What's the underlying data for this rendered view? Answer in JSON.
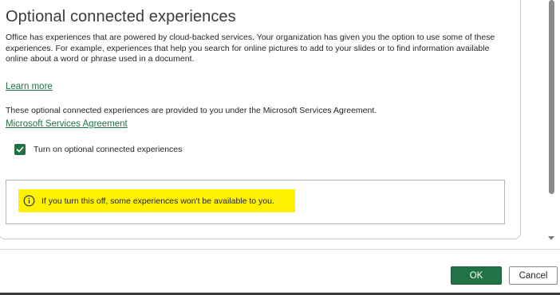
{
  "section": {
    "title": "Optional connected experiences",
    "description": "Office has experiences that are powered by cloud-backed services. Your organization has given you the option to use some of these experiences. For example, experiences that help you search for online pictures to add to your slides or to find information available online about a word or phrase used in a document.",
    "learn_more": "Learn more",
    "services_text": "These optional connected experiences are provided to you under the Microsoft Services Agreement.",
    "services_link": "Microsoft Services Agreement",
    "checkbox_label": "Turn on optional connected experiences",
    "checkbox_checked": true,
    "info_icon": "info-circle-icon",
    "info_text": "If you turn this off, some experiences won't be available to you."
  },
  "buttons": {
    "ok": "OK",
    "cancel": "Cancel"
  },
  "colors": {
    "accent": "#217346",
    "highlight": "#fff200"
  }
}
